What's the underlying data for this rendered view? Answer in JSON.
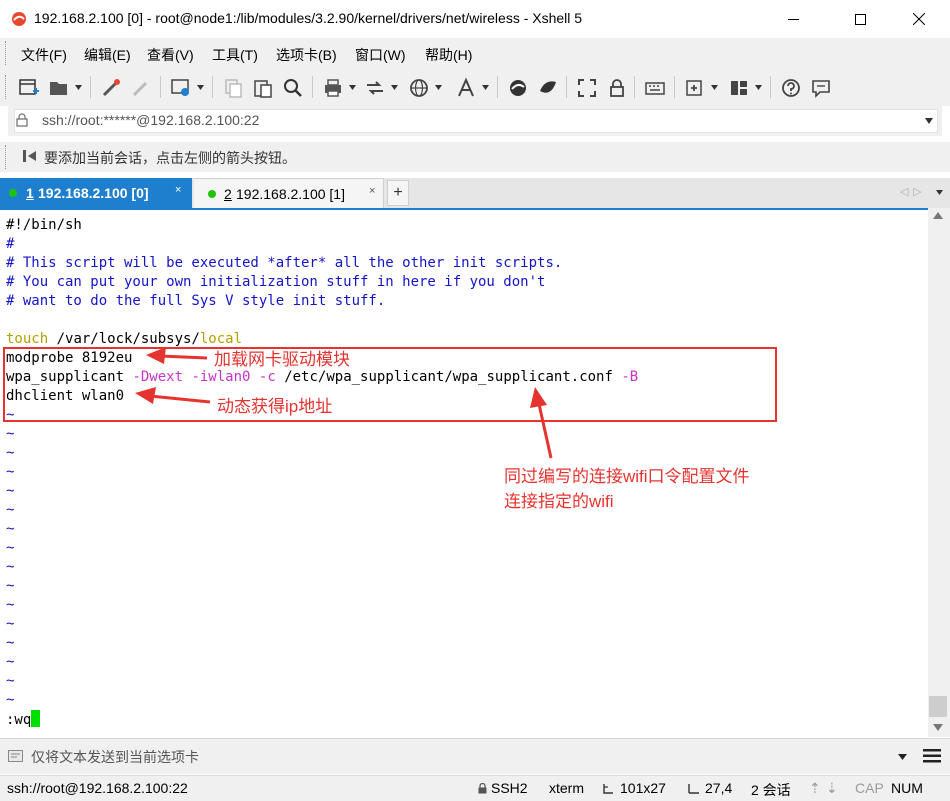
{
  "window": {
    "title": "192.168.2.100 [0] - root@node1:/lib/modules/3.2.90/kernel/drivers/net/wireless - Xshell 5"
  },
  "menu": [
    "文件(F)",
    "编辑(E)",
    "查看(V)",
    "工具(T)",
    "选项卡(B)",
    "窗口(W)",
    "帮助(H)"
  ],
  "address": {
    "value": "ssh://root:******@192.168.2.100:22"
  },
  "hint": "要添加当前会话，点击左侧的箭头按钮。",
  "tabs": [
    {
      "number": "1",
      "label": "192.168.2.100 [0]",
      "close": "×",
      "active": true
    },
    {
      "number": "2",
      "label": "192.168.2.100 [1]",
      "close": "×",
      "active": false
    }
  ],
  "tab_add": "+",
  "tab_nav": {
    "prev": "◁",
    "next": "▷"
  },
  "terminal": {
    "l1": "#!/bin/sh",
    "l2": "#",
    "l3": "# This script will be executed *after* all the other init scripts.",
    "l4": "# You can put your own initialization stuff in here if you don't",
    "l5": "# want to do the full Sys V style init stuff.",
    "l7a": "touch",
    "l7b": " /var/lock/subsys/",
    "l7c": "local",
    "l8": "modprobe 8192eu",
    "l9a": "wpa_supplicant ",
    "l9b": "-Dwext",
    "l9c": " ",
    "l9d": "-iwlan0",
    "l9e": " ",
    "l9f": "-c",
    "l9g": " /etc/wpa_supplicant/wpa_supplicant.conf ",
    "l9h": "-B",
    "l10": "dhclient wlan0",
    "tilde": "~",
    "command": ":wq"
  },
  "annotations": {
    "driver": "加载网卡驱动模块",
    "dhcp": "动态获得ip地址",
    "wpa_line1": "同过编写的连接wifi口令配置文件",
    "wpa_line2": "连接指定的wifi"
  },
  "input_bar": {
    "placeholder": "仅将文本发送到当前选项卡"
  },
  "status": {
    "connection": "ssh://root@192.168.2.100:22",
    "protocol": "SSH2",
    "terminal_type": "xterm",
    "size": "101x27",
    "cursor_pos": "27,4",
    "sessions": "2 会话",
    "up_arrow": "⇡",
    "down_arrow": "⇣",
    "cap": "CAP",
    "num": "NUM"
  },
  "colors": {
    "tab_active": "#1f7fcf",
    "annotation": "#e5342f",
    "comment": "#1414c8",
    "cursor": "#00e000"
  }
}
